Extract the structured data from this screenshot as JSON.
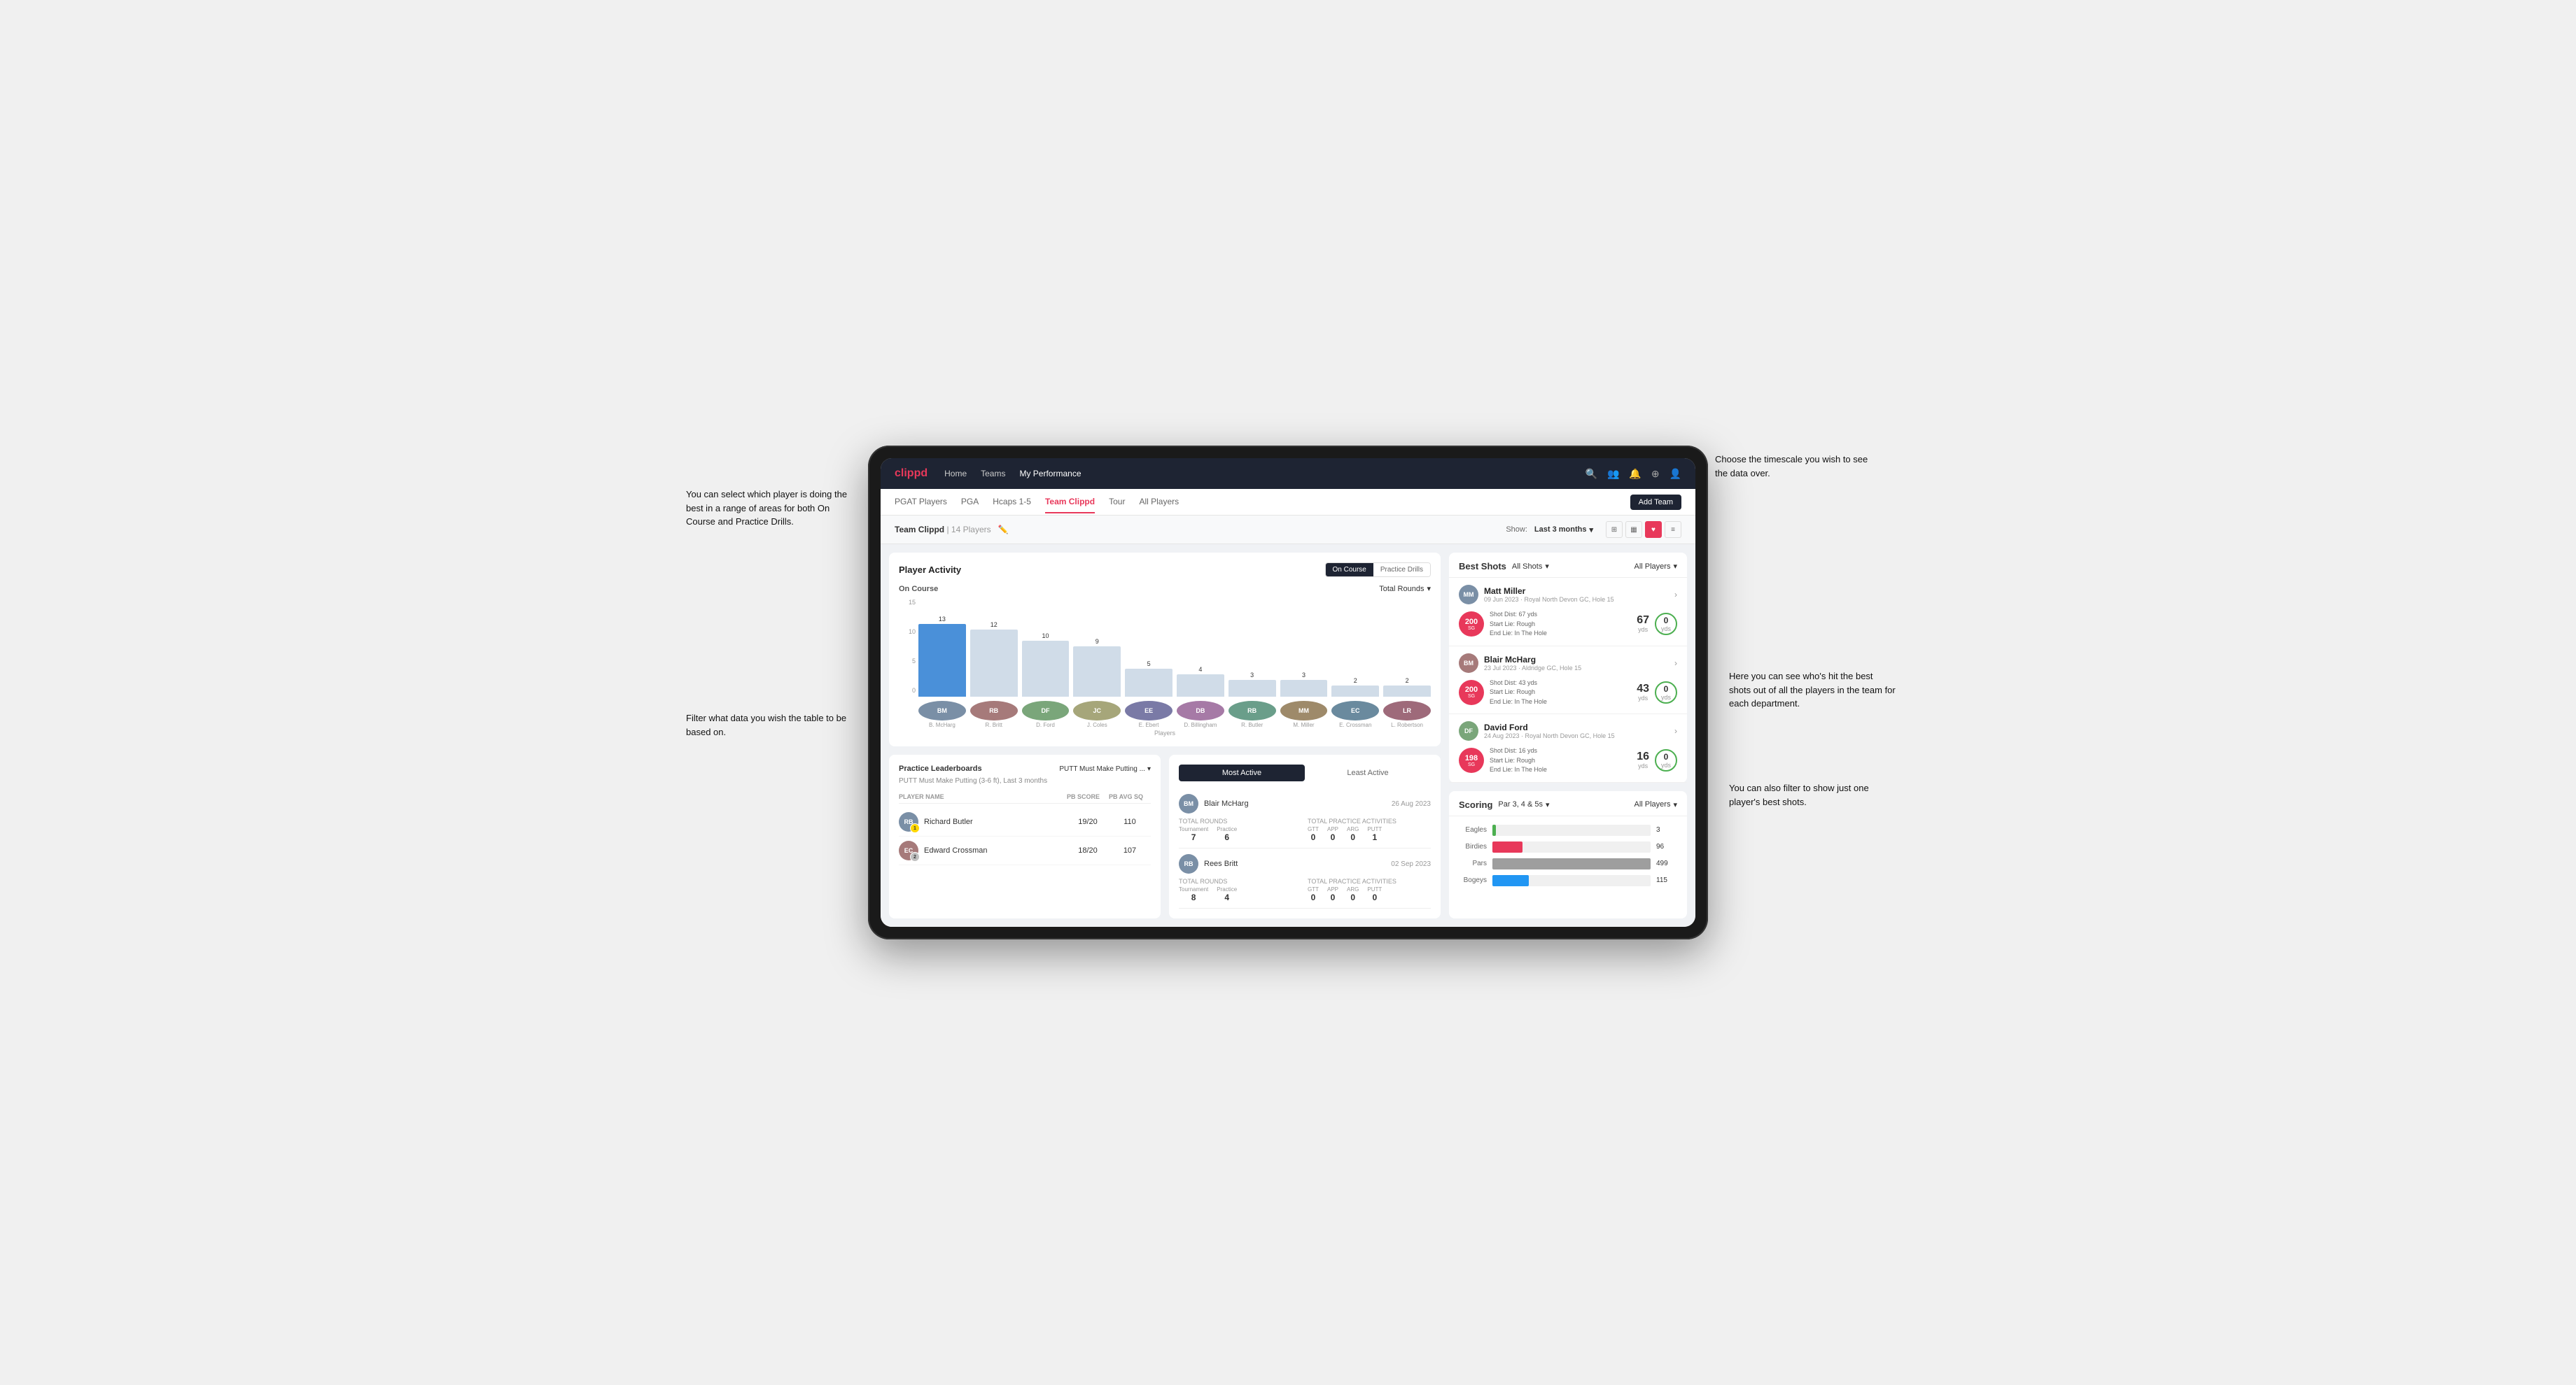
{
  "annotations": {
    "top_right": "Choose the timescale you wish to see the data over.",
    "left_top": "You can select which player is doing the best in a range of areas for both On Course and Practice Drills.",
    "left_bottom": "Filter what data you wish the table to be based on.",
    "right_mid": "Here you can see who's hit the best shots out of all the players in the team for each department.",
    "right_bottom": "You can also filter to show just one player's best shots."
  },
  "nav": {
    "logo": "clippd",
    "links": [
      "Home",
      "Teams",
      "My Performance"
    ],
    "icons": [
      "search",
      "users",
      "bell",
      "plus",
      "user"
    ]
  },
  "sub_nav": {
    "tabs": [
      "PGAT Players",
      "PGA",
      "Hcaps 1-5",
      "Team Clippd",
      "Tour",
      "All Players"
    ],
    "active": "Team Clippd",
    "action_label": "Add Team"
  },
  "team_header": {
    "title": "Team Clippd",
    "count": "14 Players",
    "show_label": "Show:",
    "period": "Last 3 months",
    "view_icons": [
      "grid-3",
      "grid-4",
      "heart",
      "settings"
    ]
  },
  "player_activity": {
    "title": "Player Activity",
    "toggle": [
      "On Course",
      "Practice Drills"
    ],
    "section": "On Course",
    "dropdown": "Total Rounds",
    "y_labels": [
      "15",
      "10",
      "5",
      "0"
    ],
    "bars": [
      {
        "name": "B. McHarg",
        "value": 13,
        "highlight": true
      },
      {
        "name": "R. Britt",
        "value": 12,
        "highlight": false
      },
      {
        "name": "D. Ford",
        "value": 10,
        "highlight": false
      },
      {
        "name": "J. Coles",
        "value": 9,
        "highlight": false
      },
      {
        "name": "E. Ebert",
        "value": 5,
        "highlight": false
      },
      {
        "name": "D. Billingham",
        "value": 4,
        "highlight": false
      },
      {
        "name": "R. Butler",
        "value": 3,
        "highlight": false
      },
      {
        "name": "M. Miller",
        "value": 3,
        "highlight": false
      },
      {
        "name": "E. Crossman",
        "value": 2,
        "highlight": false
      },
      {
        "name": "L. Robertson",
        "value": 2,
        "highlight": false
      }
    ],
    "x_label": "Players"
  },
  "best_shots": {
    "title": "Best Shots",
    "filter1": "All Shots",
    "filter2": "All Players",
    "shots": [
      {
        "player_name": "Matt Miller",
        "player_sub": "09 Jun 2023 · Royal North Devon GC, Hole 15",
        "badge_type": "pink",
        "badge_num": "200",
        "badge_label": "SG",
        "shot_dist": "67 yds",
        "start_lie": "Rough",
        "end_lie": "In The Hole",
        "stat1_val": "67",
        "stat1_unit": "yds",
        "stat2_val": "0",
        "stat2_unit": "yds"
      },
      {
        "player_name": "Blair McHarg",
        "player_sub": "23 Jul 2023 · Aldridge GC, Hole 15",
        "badge_type": "pink",
        "badge_num": "200",
        "badge_label": "SG",
        "shot_dist": "43 yds",
        "start_lie": "Rough",
        "end_lie": "In The Hole",
        "stat1_val": "43",
        "stat1_unit": "yds",
        "stat2_val": "0",
        "stat2_unit": "yds"
      },
      {
        "player_name": "David Ford",
        "player_sub": "24 Aug 2023 · Royal North Devon GC, Hole 15",
        "badge_type": "pink",
        "badge_num": "198",
        "badge_label": "SG",
        "shot_dist": "16 yds",
        "start_lie": "Rough",
        "end_lie": "In The Hole",
        "stat1_val": "16",
        "stat1_unit": "yds",
        "stat2_val": "0",
        "stat2_unit": "yds"
      }
    ]
  },
  "leaderboard": {
    "title": "Practice Leaderboards",
    "dropdown": "PUTT Must Make Putting ...",
    "subtitle": "PUTT Must Make Putting (3-6 ft), Last 3 months",
    "columns": [
      "PLAYER NAME",
      "PB SCORE",
      "PB AVG SQ"
    ],
    "rows": [
      {
        "name": "Richard Butler",
        "rank": 1,
        "pb_score": "19/20",
        "pb_avg": "110",
        "avatar_color": "#7a8fa6"
      },
      {
        "name": "Edward Crossman",
        "rank": 2,
        "pb_score": "18/20",
        "pb_avg": "107",
        "avatar_color": "#a67a7a"
      }
    ]
  },
  "most_active": {
    "tabs": [
      "Most Active",
      "Least Active"
    ],
    "players": [
      {
        "name": "Blair McHarg",
        "date": "26 Aug 2023",
        "total_rounds_label": "Total Rounds",
        "tournament": "7",
        "practice": "6",
        "total_practice_label": "Total Practice Activities",
        "gtt": "0",
        "app": "0",
        "arg": "0",
        "putt": "1"
      },
      {
        "name": "Rees Britt",
        "date": "02 Sep 2023",
        "total_rounds_label": "Total Rounds",
        "tournament": "8",
        "practice": "4",
        "total_practice_label": "Total Practice Activities",
        "gtt": "0",
        "app": "0",
        "arg": "0",
        "putt": "0"
      }
    ]
  },
  "scoring": {
    "title": "Scoring",
    "filter1": "Par 3, 4 & 5s",
    "filter2": "All Players",
    "rows": [
      {
        "label": "Eagles",
        "value": 3,
        "max": 500,
        "color": "eagles"
      },
      {
        "label": "Birdies",
        "value": 96,
        "max": 500,
        "color": "birdies"
      },
      {
        "label": "Pars",
        "value": 499,
        "max": 500,
        "color": "pars"
      },
      {
        "label": "Bogeys",
        "value": 115,
        "max": 500,
        "color": "bogeys"
      }
    ]
  }
}
